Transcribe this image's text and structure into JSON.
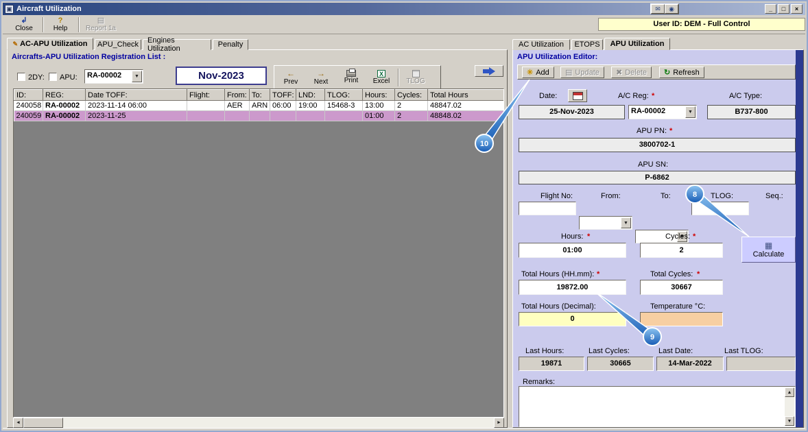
{
  "window": {
    "title": "Aircraft Utilization",
    "user_id": "User ID: DEM - Full Control"
  },
  "toolbar": {
    "close": "Close",
    "help": "Help",
    "report": "Report 1a"
  },
  "left": {
    "tabs": [
      "AC-APU Utilization",
      "APU_Check",
      "Engines Utilization",
      "Penalty"
    ],
    "section_title": "Aircrafts-APU Utilization Registration List :",
    "filters": {
      "dy": "2DY:",
      "apu": "APU:",
      "reg": "RA-00002",
      "month": "Nov-2023"
    },
    "nav": {
      "prev": "Prev",
      "next": "Next",
      "print": "Print",
      "excel": "Excel",
      "tlog": "TLOG"
    },
    "table": {
      "columns": [
        "ID:",
        "REG:",
        "Date TOFF:",
        "Flight:",
        "From:",
        "To:",
        "TOFF:",
        "LND:",
        "TLOG:",
        "Hours:",
        "Cycles:",
        "Total Hours"
      ],
      "rows": [
        {
          "cells": [
            "240058",
            "RA-00002",
            "2023-11-14 06:00",
            "",
            "AER",
            "ARN",
            "06:00",
            "19:00",
            "15468-3",
            "13:00",
            "2",
            "48847.02"
          ]
        },
        {
          "cells": [
            "240059",
            "RA-00002",
            "2023-11-25",
            "",
            "",
            "",
            "",
            "",
            "",
            "01:00",
            "2",
            "48848.02"
          ]
        }
      ]
    }
  },
  "right": {
    "tabs": [
      "AC Utilization",
      "ETOPS",
      "APU Utilization"
    ],
    "section_title": "APU Utilization Editor:",
    "toolbar": {
      "add": "Add",
      "update": "Update",
      "delete": "Delete",
      "refresh": "Refresh"
    },
    "required_marker": "*",
    "fields": {
      "date_label": "Date:",
      "date_value": "25-Nov-2023",
      "ac_reg_label": "A/C Reg:",
      "ac_reg_value": "RA-00002",
      "ac_type_label": "A/C Type:",
      "ac_type_value": "B737-800",
      "apu_pn_label": "APU PN:",
      "apu_pn_value": "3800702-1",
      "apu_sn_label": "APU SN:",
      "apu_sn_value": "P-6862",
      "flight_no_label": "Flight No:",
      "flight_no_value": "",
      "from_label": "From:",
      "from_value": "",
      "to_label": "To:",
      "to_value": "",
      "tlog_label": "TLOG:",
      "tlog_value": "",
      "seq_label": "Seq.:",
      "seq_value": "",
      "hours_label": "Hours:",
      "hours_value": "01:00",
      "cycles_label": "Cycles:",
      "cycles_value": "2",
      "calculate_label": "Calculate",
      "total_hours_label": "Total Hours (HH.mm):",
      "total_hours_value": "19872.00",
      "total_cycles_label": "Total Cycles:",
      "total_cycles_value": "30667",
      "total_hours_dec_label": "Total Hours (Decimal):",
      "total_hours_dec_value": "0",
      "temperature_label": "Temperature °C:",
      "temperature_value": "",
      "last_hours_label": "Last Hours:",
      "last_hours_value": "19871",
      "last_cycles_label": "Last Cycles:",
      "last_cycles_value": "30665",
      "last_date_label": "Last Date:",
      "last_date_value": "14-Mar-2022",
      "last_tlog_label": "Last TLOG:",
      "last_tlog_value": "",
      "remarks_label": "Remarks:"
    }
  },
  "callouts": {
    "c10": "10",
    "c8": "8",
    "c9": "9"
  },
  "icons": {
    "app": "▣",
    "minimize": "_",
    "maximize": "□",
    "close_x": "×",
    "mail": "✉",
    "target": "◉",
    "close": "↲",
    "help": "?",
    "report": "▤",
    "tab_edit": "✎",
    "prev": "←",
    "next": "→",
    "excel_x": "X",
    "dropdown": "▼",
    "left_arrow": "◄",
    "right_arrow": "►",
    "up_arrow": "▲",
    "down_arrow": "▼",
    "add": "✳",
    "update": "▤",
    "delete": "✖",
    "refresh": "↻",
    "calc": "▦"
  },
  "colors": {
    "title_accent": "#29457f",
    "section_blue": "#0000a0",
    "selected_row": "#cc99cc",
    "panel_lavender": "#cbcbed",
    "user_box_yellow": "#ffffcc",
    "decimal_yellow": "#ffffc0",
    "temperature_orange": "#f7cfa2",
    "callout_blue": "#155ab4"
  }
}
